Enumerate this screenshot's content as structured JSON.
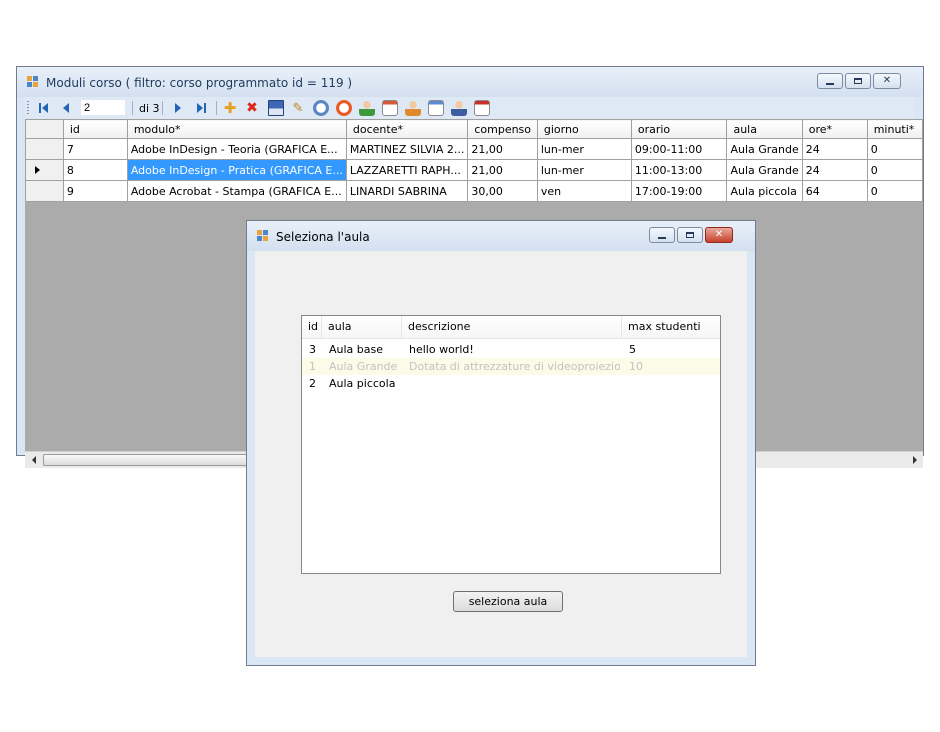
{
  "main_window": {
    "title": "Moduli corso ( filtro: corso programmato id = 119 )",
    "navigator": {
      "position": "2",
      "count_label": "di 3"
    },
    "grid": {
      "columns": [
        "id",
        "modulo*",
        "docente*",
        "compenso",
        "giorno",
        "orario",
        "aula",
        "ore*",
        "minuti*"
      ],
      "rows": [
        {
          "id": "7",
          "modulo": "Adobe InDesign - Teoria (GRAFICA E...",
          "docente": "MARTINEZ SILVIA 2...",
          "compenso": "21,00",
          "giorno": "lun-mer",
          "orario": "09:00-11:00",
          "aula": "Aula Grande",
          "ore": "24",
          "minuti": "0",
          "current": false
        },
        {
          "id": "8",
          "modulo": "Adobe InDesign - Pratica (GRAFICA E...",
          "docente": "LAZZARETTI RAPH...",
          "compenso": "21,00",
          "giorno": "lun-mer",
          "orario": "11:00-13:00",
          "aula": "Aula Grande",
          "ore": "24",
          "minuti": "0",
          "current": true
        },
        {
          "id": "9",
          "modulo": "Adobe Acrobat - Stampa (GRAFICA E...",
          "docente": "LINARDI SABRINA",
          "compenso": "30,00",
          "giorno": "ven",
          "orario": "17:00-19:00",
          "aula": "Aula piccola",
          "ore": "64",
          "minuti": "0",
          "current": false
        }
      ]
    },
    "toolbar_icons": [
      "move-first-icon",
      "move-previous-icon",
      "move-next-icon",
      "move-last-icon",
      "add-icon",
      "delete-icon",
      "save-icon",
      "wand-icon",
      "clock-icon",
      "alarm-clock-icon",
      "user-icon",
      "calendar-icon",
      "user-icon",
      "calendar-icon",
      "user-icon",
      "calendar-icon"
    ]
  },
  "dialog": {
    "title": "Seleziona l'aula",
    "list": {
      "columns": [
        "id",
        "aula",
        "descrizione",
        "max studenti"
      ],
      "rows": [
        {
          "id": "3",
          "aula": "Aula base",
          "descrizione": "hello world!",
          "max": "5",
          "disabled": false
        },
        {
          "id": "1",
          "aula": "Aula Grande",
          "descrizione": "Dotata di attrezzature di videoproiezione e...",
          "max": "10",
          "disabled": true
        },
        {
          "id": "2",
          "aula": "Aula piccola",
          "descrizione": "",
          "max": "",
          "disabled": false
        }
      ]
    },
    "select_button": "seleziona aula"
  },
  "colors": {
    "selection": "#3399ff",
    "grid_background": "#ababab",
    "disabled_row": "#fbfbe8",
    "close_button": "#c7412a"
  }
}
